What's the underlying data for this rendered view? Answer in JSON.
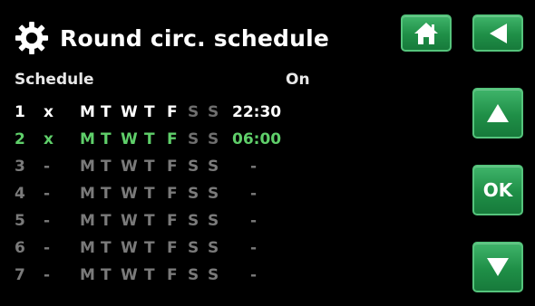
{
  "header": {
    "title": "Round circ. schedule",
    "icon": "gear-icon"
  },
  "buttons": {
    "home_icon": "home-icon",
    "back_icon": "back-arrow-icon",
    "up_icon": "up-arrow-icon",
    "ok_label": "OK",
    "down_icon": "down-arrow-icon",
    "accent_color": "#1f8f47"
  },
  "columns": {
    "schedule": "Schedule",
    "on": "On"
  },
  "rows": [
    {
      "num": "1",
      "active": "x",
      "days": [
        "M",
        "T",
        "W",
        "T",
        "F",
        "S",
        "S"
      ],
      "time": "22:30",
      "style": "white",
      "active_days": 5
    },
    {
      "num": "2",
      "active": "x",
      "days": [
        "M",
        "T",
        "W",
        "T",
        "F",
        "S",
        "S"
      ],
      "time": "06:00",
      "style": "green",
      "active_days": 5
    },
    {
      "num": "3",
      "active": "-",
      "days": [
        "M",
        "T",
        "W",
        "T",
        "F",
        "S",
        "S"
      ],
      "time": "-",
      "style": "gray",
      "active_days": 0
    },
    {
      "num": "4",
      "active": "-",
      "days": [
        "M",
        "T",
        "W",
        "T",
        "F",
        "S",
        "S"
      ],
      "time": "-",
      "style": "gray",
      "active_days": 0
    },
    {
      "num": "5",
      "active": "-",
      "days": [
        "M",
        "T",
        "W",
        "T",
        "F",
        "S",
        "S"
      ],
      "time": "-",
      "style": "gray",
      "active_days": 0
    },
    {
      "num": "6",
      "active": "-",
      "days": [
        "M",
        "T",
        "W",
        "T",
        "F",
        "S",
        "S"
      ],
      "time": "-",
      "style": "gray",
      "active_days": 0
    },
    {
      "num": "7",
      "active": "-",
      "days": [
        "M",
        "T",
        "W",
        "T",
        "F",
        "S",
        "S"
      ],
      "time": "-",
      "style": "gray",
      "active_days": 0
    }
  ]
}
